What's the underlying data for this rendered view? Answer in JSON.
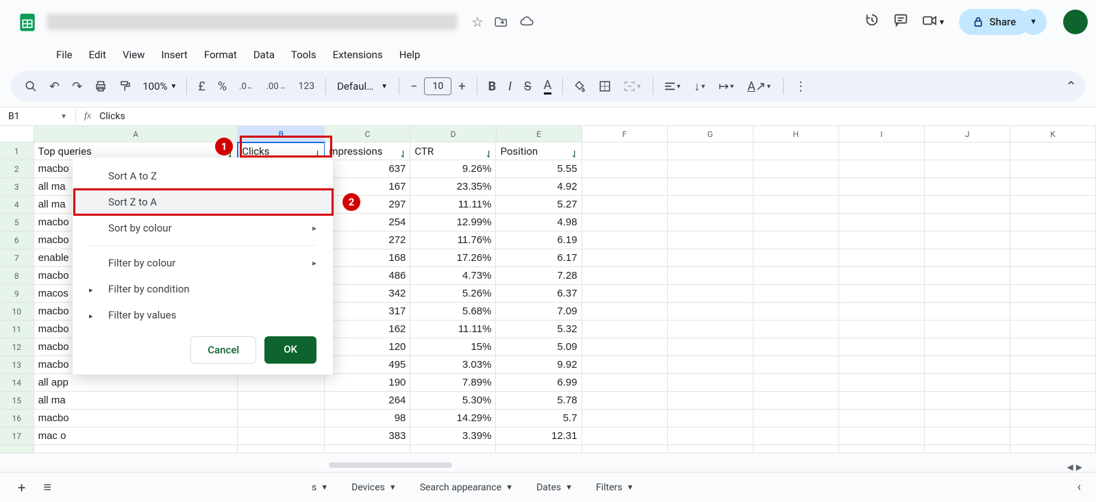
{
  "menubar": [
    "File",
    "Edit",
    "View",
    "Insert",
    "Format",
    "Data",
    "Tools",
    "Extensions",
    "Help"
  ],
  "toolbar": {
    "zoom": "100%",
    "font": "Defaul…",
    "size": "10"
  },
  "share_label": "Share",
  "namebox": "B1",
  "formula": "Clicks",
  "col_letters": [
    "A",
    "B",
    "C",
    "D",
    "E",
    "F",
    "G",
    "H",
    "I",
    "J",
    "K"
  ],
  "headers": {
    "A": "Top queries",
    "B": "Clicks",
    "C": "mpressions",
    "D": "CTR",
    "E": "Position"
  },
  "rows": [
    {
      "n": 2,
      "A": "macbo",
      "C": "637",
      "D": "9.26%",
      "E": "5.55"
    },
    {
      "n": 3,
      "A": "all ma",
      "C": "167",
      "D": "23.35%",
      "E": "4.92"
    },
    {
      "n": 4,
      "A": "all ma",
      "C": "297",
      "D": "11.11%",
      "E": "5.27"
    },
    {
      "n": 5,
      "A": "macbo",
      "C": "254",
      "D": "12.99%",
      "E": "4.98"
    },
    {
      "n": 6,
      "A": "macbo",
      "C": "272",
      "D": "11.76%",
      "E": "6.19"
    },
    {
      "n": 7,
      "A": "enable",
      "C": "168",
      "D": "17.26%",
      "E": "6.17"
    },
    {
      "n": 8,
      "A": "macbo",
      "C": "486",
      "D": "4.73%",
      "E": "7.28"
    },
    {
      "n": 9,
      "A": "macos",
      "C": "342",
      "D": "5.26%",
      "E": "6.37"
    },
    {
      "n": 10,
      "A": "macbo",
      "C": "317",
      "D": "5.68%",
      "E": "7.09"
    },
    {
      "n": 11,
      "A": "macbo",
      "C": "162",
      "D": "11.11%",
      "E": "5.32"
    },
    {
      "n": 12,
      "A": "macbo",
      "C": "120",
      "D": "15%",
      "E": "5.09"
    },
    {
      "n": 13,
      "A": "macbo",
      "C": "495",
      "D": "3.03%",
      "E": "9.92"
    },
    {
      "n": 14,
      "A": "all app",
      "C": "190",
      "D": "7.89%",
      "E": "6.99"
    },
    {
      "n": 15,
      "A": "all ma",
      "C": "264",
      "D": "5.30%",
      "E": "5.78"
    },
    {
      "n": 16,
      "A": "macbo",
      "C": "98",
      "D": "14.29%",
      "E": "5.7"
    },
    {
      "n": 17,
      "A": "mac o",
      "C": "383",
      "D": "3.39%",
      "E": "12.31"
    }
  ],
  "popup": {
    "sort_az": "Sort A to Z",
    "sort_za": "Sort Z to A",
    "sort_colour": "Sort by colour",
    "filter_colour": "Filter by colour",
    "filter_condition": "Filter by condition",
    "filter_values": "Filter by values",
    "cancel": "Cancel",
    "ok": "OK"
  },
  "tabs": [
    "s",
    "Devices",
    "Search appearance",
    "Dates",
    "Filters"
  ],
  "badges": {
    "b1": "1",
    "b2": "2"
  }
}
